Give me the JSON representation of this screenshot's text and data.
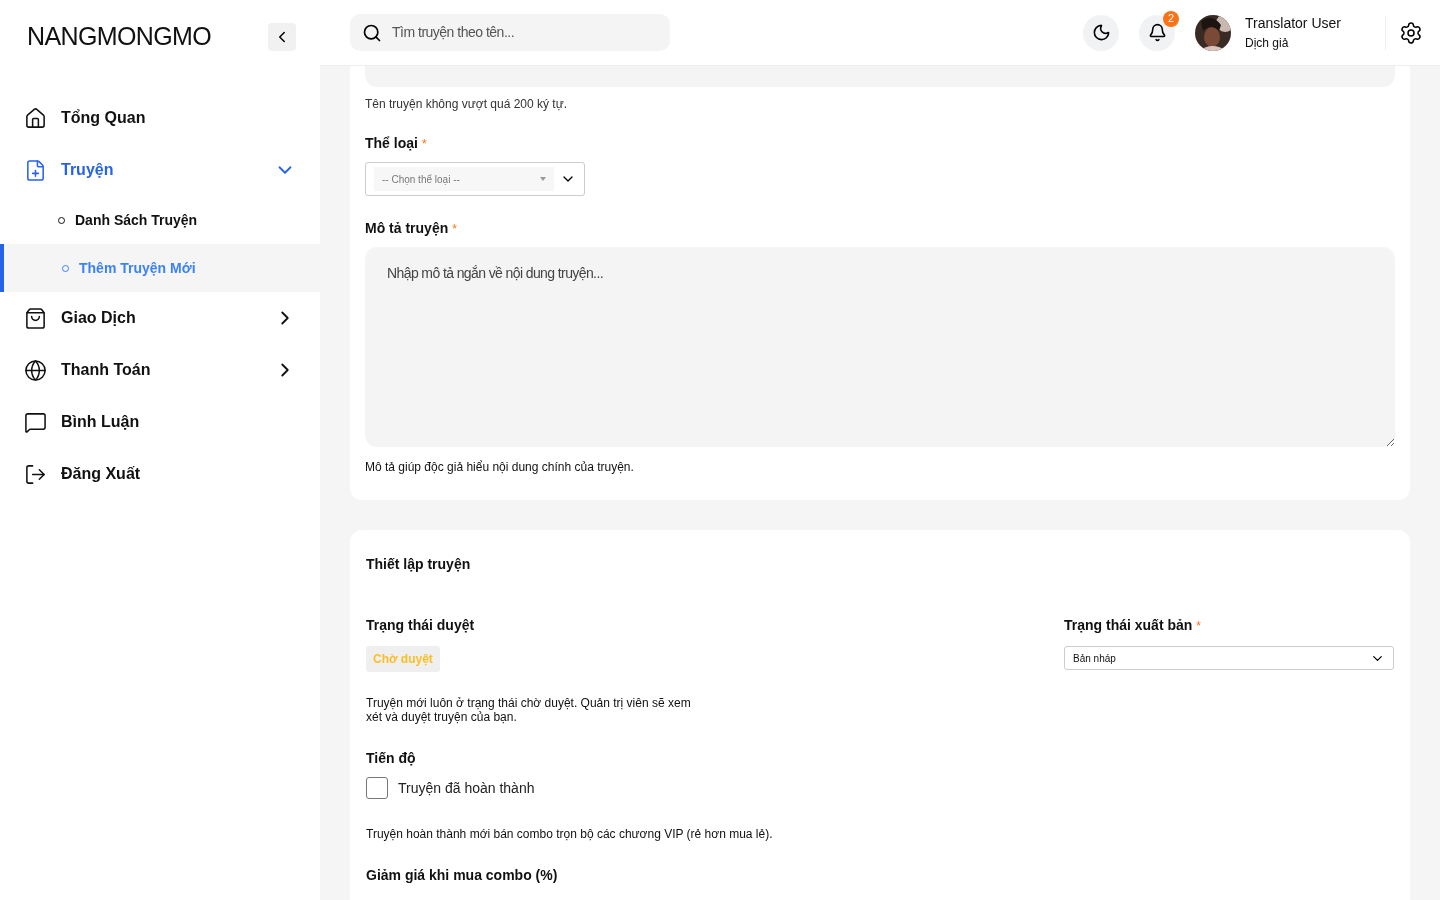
{
  "sidebar": {
    "logo": "NANGMONGMO",
    "items": [
      {
        "label": "Tổng Quan",
        "kind": "link",
        "selected": false
      },
      {
        "label": "Truyện",
        "kind": "group",
        "selected": true,
        "expanded": true,
        "children": [
          {
            "label": "Danh Sách Truyện",
            "selected": false
          },
          {
            "label": "Thêm Truyện Mới",
            "selected": true
          }
        ]
      },
      {
        "label": "Giao Dịch",
        "kind": "group",
        "selected": false,
        "expanded": false
      },
      {
        "label": "Thanh Toán",
        "kind": "group",
        "selected": false,
        "expanded": false
      },
      {
        "label": "Bình Luận",
        "kind": "link",
        "selected": false
      },
      {
        "label": "Đăng Xuất",
        "kind": "link",
        "selected": false
      }
    ]
  },
  "header": {
    "search": {
      "placeholder": "Tìm truyện theo tên..."
    },
    "notifications": "2",
    "user": {
      "name": "Translator User",
      "role": "Dịch giả"
    }
  },
  "story_card": {
    "name_hint": "Tên truyện không vượt quá 200 ký tự.",
    "genre": {
      "label": "Thể loại",
      "required": "*",
      "placeholder": "-- Chọn thể loại --"
    },
    "description": {
      "label": "Mô tả truyện",
      "required": "*",
      "placeholder": "Nhập mô tả ngắn về nội dung truyện...",
      "hint": "Mô tả giúp độc giả hiểu nội dung chính của truyện."
    }
  },
  "settings_card": {
    "title": "Thiết lập truyện",
    "review": {
      "label": "Trạng thái duyệt",
      "badge": "Chờ duyệt",
      "hint": "Truyện mới luôn ở trạng thái chờ duyệt. Quản trị viên sẽ xem xét và duyệt truyện của bạn."
    },
    "publish": {
      "label": "Trạng thái xuất bản",
      "required": "*",
      "value": "Bản nháp"
    },
    "progress": {
      "label": "Tiến độ",
      "checkbox": "Truyện đã hoàn thành",
      "checked": false,
      "hint": "Truyện hoàn thành mới bán combo trọn bộ các chương VIP (rẻ hơn mua lẻ)."
    },
    "discount": {
      "label": "Giảm giá khi mua combo (%)"
    }
  }
}
